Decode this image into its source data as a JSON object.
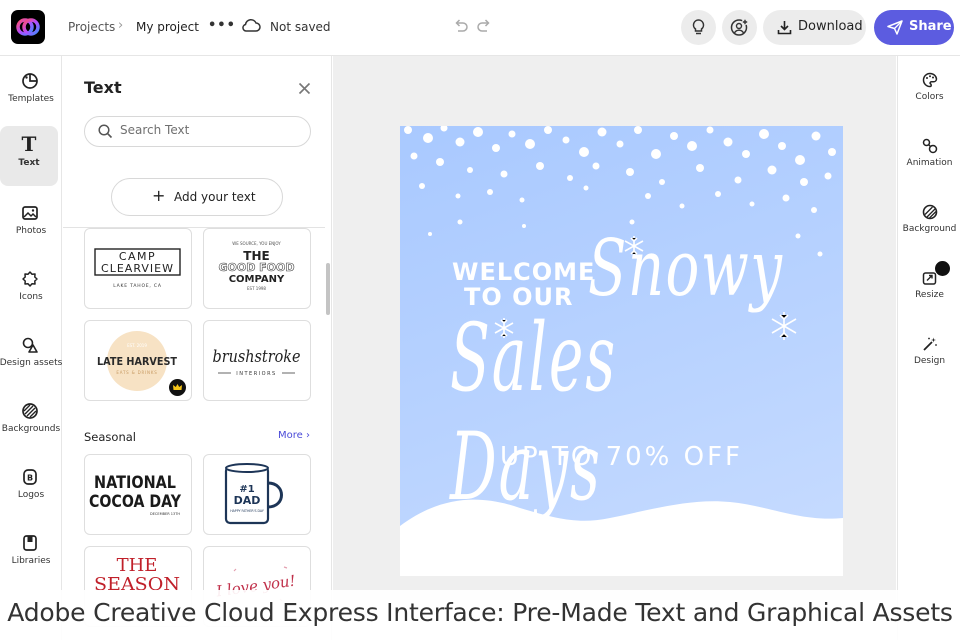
{
  "header": {
    "breadcrumb_root": "Projects",
    "breadcrumb_current": "My project",
    "more_label": "•••",
    "save_status": "Not saved",
    "download_label": "Download",
    "share_label": "Share",
    "accent_color": "#5c5ce0"
  },
  "left_rail": {
    "items": [
      {
        "label": "Templates",
        "icon": "templates-icon"
      },
      {
        "label": "Text",
        "icon": "text-icon",
        "active": true
      },
      {
        "label": "Photos",
        "icon": "photos-icon"
      },
      {
        "label": "Icons",
        "icon": "icons-icon"
      },
      {
        "label": "Design assets",
        "icon": "design-assets-icon"
      },
      {
        "label": "Backgrounds",
        "icon": "backgrounds-icon"
      },
      {
        "label": "Logos",
        "icon": "logos-icon"
      },
      {
        "label": "Libraries",
        "icon": "libraries-icon"
      }
    ]
  },
  "panel": {
    "title": "Text",
    "search_placeholder": "Search Text",
    "add_text_label": "Add your text",
    "tiles": {
      "camp_line1": "CAMP",
      "camp_line2": "CLEARVIEW",
      "camp_sub": "LAKE TAHOE, CA",
      "food_top": "WE SOURCE, YOU ENJOY",
      "food_line1": "THE",
      "food_line2": "GOOD FOOD",
      "food_line3": "COMPANY",
      "food_sub": "EST 1998",
      "harvest_top": "EST. 2019",
      "harvest_main": "LATE HARVEST",
      "harvest_sub": "EATS & DRINKS",
      "brush_main": "brushstroke",
      "brush_sub": "INTERIORS",
      "cocoa_line1": "NATIONAL",
      "cocoa_line2": "COCOA DAY",
      "cocoa_sub": "DECEMBER 13TH",
      "dad_line1": "#1",
      "dad_line2": "DAD",
      "dad_sub": "HAPPY FATHER'S DAY",
      "season_line1": "THE",
      "season_line2": "SEASON",
      "love_text": "I love you!"
    },
    "section_title": "Seasonal",
    "section_more": "More ›"
  },
  "artboard": {
    "welcome_line1": "WELCOME",
    "welcome_line2": "TO OUR",
    "snowy": "Snowy",
    "sales_days": "Sales Days",
    "offer": "UP TO 70% OFF"
  },
  "right_rail": {
    "items": [
      {
        "label": "Colors",
        "icon": "colors-icon"
      },
      {
        "label": "Animation",
        "icon": "animation-icon"
      },
      {
        "label": "Background",
        "icon": "background-icon"
      },
      {
        "label": "Resize",
        "icon": "resize-icon"
      },
      {
        "label": "Design",
        "icon": "design-icon"
      }
    ]
  },
  "caption": "Adobe Creative Cloud Express Interface: Pre-Made Text and Graphical Assets"
}
